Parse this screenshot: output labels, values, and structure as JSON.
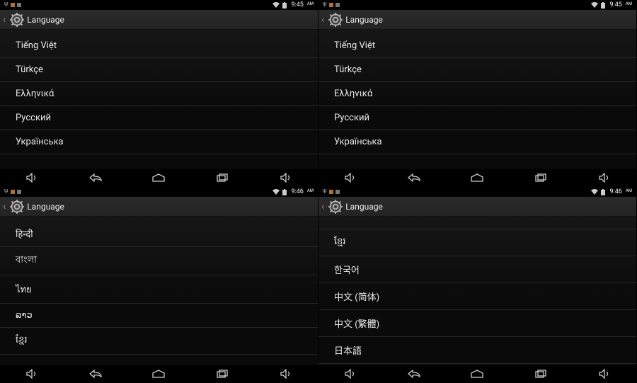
{
  "panes": [
    {
      "status": {
        "time": "9:45",
        "ampm": "AM"
      },
      "header": {
        "title": "Language"
      },
      "items": [
        {
          "label": "Tiếng Việt"
        },
        {
          "label": "Türkçe"
        },
        {
          "label": "Ελληνικά"
        },
        {
          "label": "Русский"
        },
        {
          "label": "Українська"
        }
      ]
    },
    {
      "status": {
        "time": "9:45",
        "ampm": "AM"
      },
      "header": {
        "title": "Language"
      },
      "items": [
        {
          "label": "Tiếng Việt"
        },
        {
          "label": "Türkçe"
        },
        {
          "label": "Ελληνικά"
        },
        {
          "label": "Русский"
        },
        {
          "label": "Українська"
        }
      ]
    },
    {
      "status": {
        "time": "9:46",
        "ampm": "AM"
      },
      "header": {
        "title": "Language"
      },
      "items": [
        {
          "label": "हिन्दी"
        },
        {
          "label": "বাংলা"
        },
        {
          "label": "ไทย"
        },
        {
          "label": "ລາວ"
        },
        {
          "label": "ខ្មែរ"
        }
      ]
    },
    {
      "status": {
        "time": "9:46",
        "ampm": "AM"
      },
      "header": {
        "title": "Language"
      },
      "partial_top": true,
      "items": [
        {
          "label": "ខ្មែរ"
        },
        {
          "label": "한국어"
        },
        {
          "label": "中文 (简体)"
        },
        {
          "label": "中文 (繁體)"
        },
        {
          "label": "日本語"
        }
      ]
    }
  ]
}
